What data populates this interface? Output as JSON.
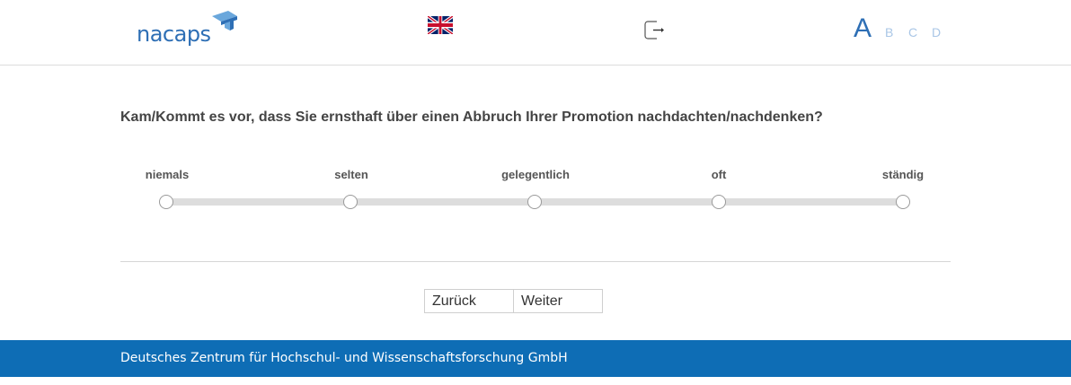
{
  "header": {
    "logo_text": "nacaps",
    "language_flag": "uk-flag-icon",
    "logout_icon": "logout-icon",
    "font_size": {
      "large": "A",
      "options": [
        "B",
        "C",
        "D"
      ]
    }
  },
  "question": {
    "text": "Kam/Kommt es vor, dass Sie ernsthaft über einen Abbruch Ihrer Promotion nachdachten/nachdenken?",
    "scale_labels": [
      "niemals",
      "selten",
      "gelegentlich",
      "oft",
      "ständig"
    ],
    "selected": null
  },
  "navigation": {
    "back_label": "Zurück",
    "next_label": "Weiter"
  },
  "footer": {
    "text": "Deutsches Zentrum für Hochschul- und Wissenschaftsforschung GmbH"
  },
  "colors": {
    "brand_blue": "#2e6fb5",
    "footer_blue": "#0e6db5",
    "light_blue": "#a9c6e6"
  }
}
